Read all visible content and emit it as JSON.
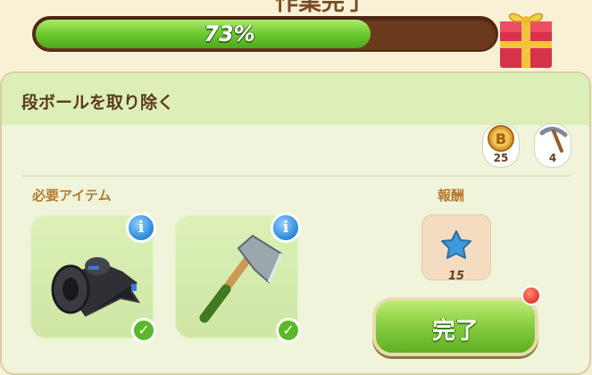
{
  "header": {
    "title": "作業完了",
    "progress_text": "73%",
    "progress": 0.73
  },
  "task": {
    "title": "段ボールを取り除く"
  },
  "resources": [
    {
      "icon": "coin-icon",
      "count": "25"
    },
    {
      "icon": "pickaxe-icon",
      "count": "4"
    }
  ],
  "required": {
    "label": "必要アイテム",
    "items": [
      {
        "icon": "tape-roll-icon",
        "info": "i",
        "check": "✓"
      },
      {
        "icon": "axe-icon",
        "info": "i",
        "check": "✓"
      }
    ]
  },
  "reward": {
    "label": "報酬",
    "icon": "blue-star-icon",
    "count": "15"
  },
  "complete_button": {
    "label": "完了"
  },
  "colors": {
    "progress_fill": "#71cc32",
    "button_green": "#86cc3e",
    "notify_red": "#e53a28",
    "info_blue": "#2c86d8"
  }
}
